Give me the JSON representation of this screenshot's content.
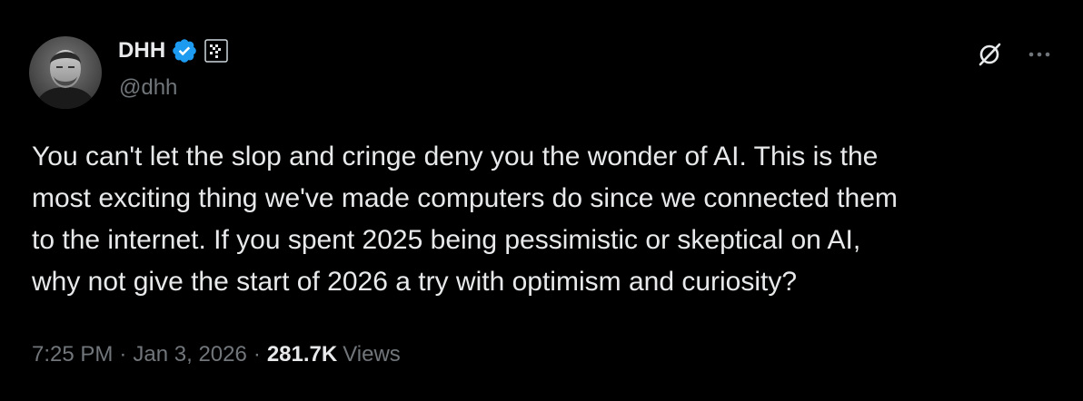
{
  "author": {
    "display_name": "DHH",
    "handle": "@dhh",
    "avatar": "profile-photo",
    "badges": [
      "verified-badge-icon",
      "affiliate-badge-icon"
    ]
  },
  "tweet": {
    "text_lines": [
      "You can't let the slop and cringe deny you the wonder of AI. This is the",
      "most exciting thing we've made computers do since we connected them",
      "to the internet. If you spent 2025 being pessimistic or skeptical on AI,",
      "why not give the start of 2026 a try with optimism and curiosity?"
    ]
  },
  "meta": {
    "time": "7:25 PM",
    "separator": "·",
    "date": "Jan 3, 2026",
    "views_count": "281.7K",
    "views_label": "Views"
  },
  "actions": {
    "grok_icon": "grok-icon",
    "more_icon": "more-options-icon"
  },
  "colors": {
    "background": "#000000",
    "primary_text": "#e7e9ea",
    "secondary_text": "#71767b",
    "verified_blue": "#1d9bf0"
  }
}
